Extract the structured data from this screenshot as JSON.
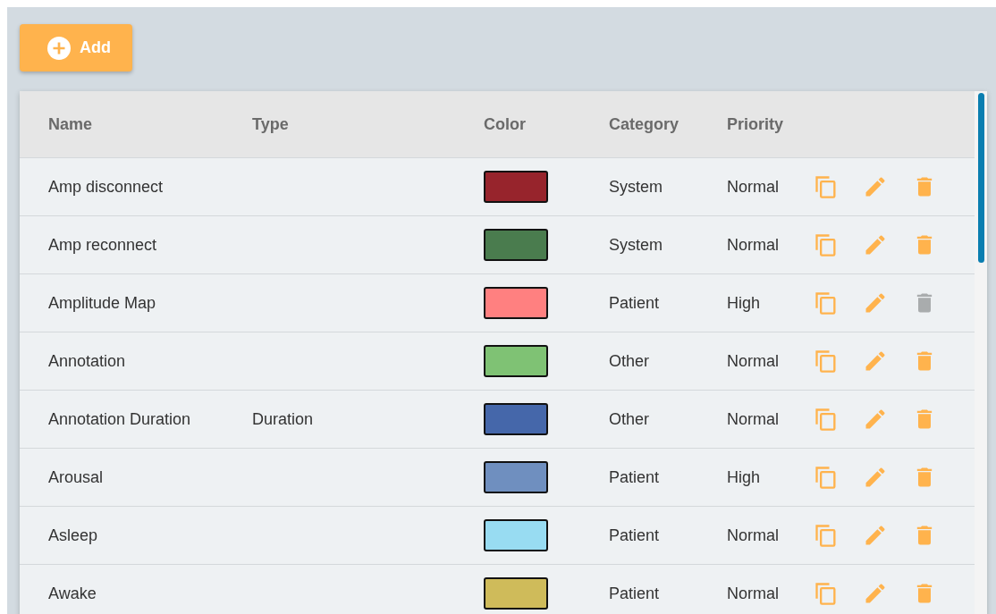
{
  "add_button": {
    "label": "Add"
  },
  "table": {
    "columns": [
      "Name",
      "Type",
      "Color",
      "Category",
      "Priority"
    ],
    "rows": [
      {
        "name": "Amp disconnect",
        "type": "",
        "color": "#97242c",
        "category": "System",
        "priority": "Normal",
        "delete_disabled": false
      },
      {
        "name": "Amp reconnect",
        "type": "",
        "color": "#4a7c4e",
        "category": "System",
        "priority": "Normal",
        "delete_disabled": false
      },
      {
        "name": "Amplitude Map",
        "type": "",
        "color": "#ff8080",
        "category": "Patient",
        "priority": "High",
        "delete_disabled": true
      },
      {
        "name": "Annotation",
        "type": "",
        "color": "#7fc274",
        "category": "Other",
        "priority": "Normal",
        "delete_disabled": false
      },
      {
        "name": "Annotation Duration",
        "type": "Duration",
        "color": "#4567aa",
        "category": "Other",
        "priority": "Normal",
        "delete_disabled": false
      },
      {
        "name": "Arousal",
        "type": "",
        "color": "#6f8fbf",
        "category": "Patient",
        "priority": "High",
        "delete_disabled": false
      },
      {
        "name": "Asleep",
        "type": "",
        "color": "#98dcf2",
        "category": "Patient",
        "priority": "Normal",
        "delete_disabled": false
      },
      {
        "name": "Awake",
        "type": "",
        "color": "#cfbb5a",
        "category": "Patient",
        "priority": "Normal",
        "delete_disabled": false
      }
    ]
  }
}
